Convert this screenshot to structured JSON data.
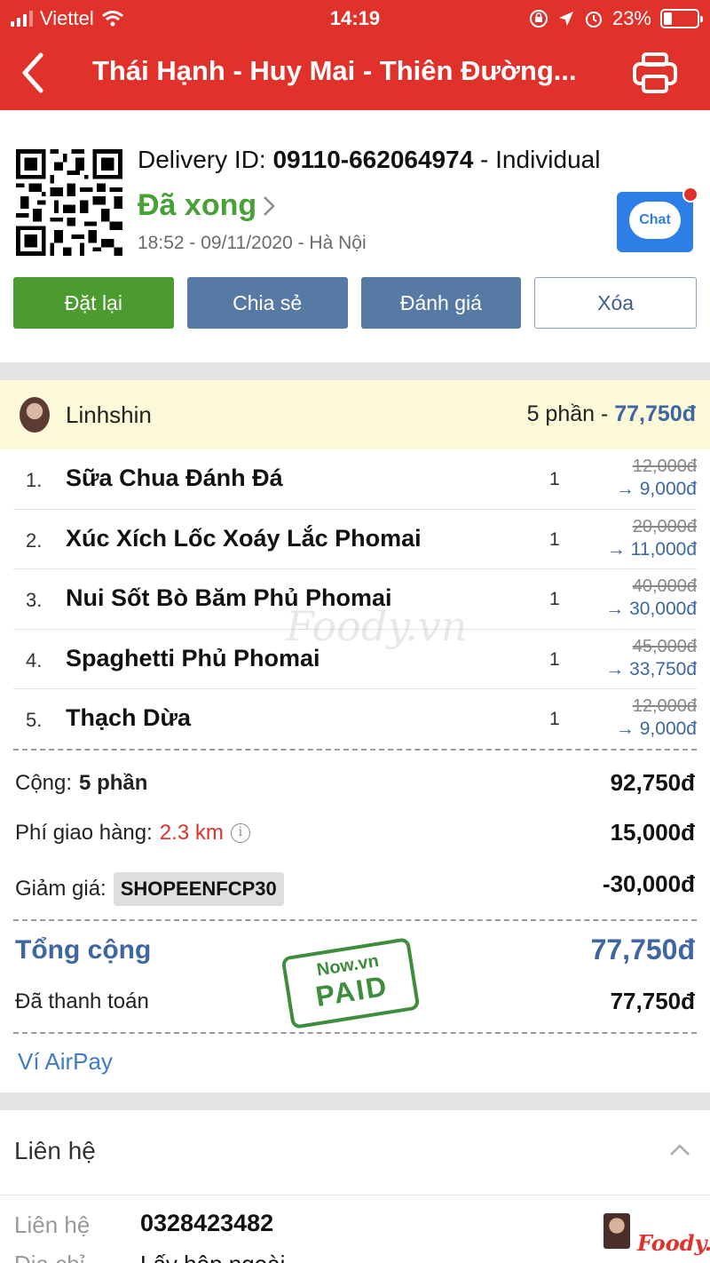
{
  "status_bar": {
    "carrier": "Viettel",
    "time": "14:19",
    "battery": "23%"
  },
  "nav": {
    "title": "Thái Hạnh - Huy Mai - Thiên Đường..."
  },
  "order": {
    "delivery_prefix": "Delivery ID: ",
    "delivery_id": "09110-662064974",
    "delivery_suffix": " - Individual",
    "status": "Đã xong",
    "datetime": "18:52 - 09/11/2020 - Hà Nội",
    "chat_label": "Chat"
  },
  "actions": {
    "reorder": "Đặt lại",
    "share": "Chia sẻ",
    "rate": "Đánh giá",
    "delete": "Xóa"
  },
  "group": {
    "user": "Linhshin",
    "summary_qty": "5 phần",
    "summary_sep": " - ",
    "summary_total": "77,750đ"
  },
  "items": [
    {
      "num": "1.",
      "name": "Sữa Chua Đánh Đá",
      "qty": "1",
      "old_price": "12,000đ",
      "new_price": "→ 9,000đ"
    },
    {
      "num": "2.",
      "name": "Xúc Xích Lốc Xoáy Lắc Phomai",
      "qty": "1",
      "old_price": "20,000đ",
      "new_price": "→ 11,000đ"
    },
    {
      "num": "3.",
      "name": "Nui Sốt Bò Băm Phủ Phomai",
      "qty": "1",
      "old_price": "40,000đ",
      "new_price": "→ 30,000đ"
    },
    {
      "num": "4.",
      "name": "Spaghetti Phủ Phomai",
      "qty": "1",
      "old_price": "45,000đ",
      "new_price": "→ 33,750đ"
    },
    {
      "num": "5.",
      "name": "Thạch Dừa",
      "qty": "1",
      "old_price": "12,000đ",
      "new_price": "→ 9,000đ"
    }
  ],
  "summary": {
    "subtotal_label": "Cộng:",
    "subtotal_count": "5 phần",
    "subtotal_value": "92,750đ",
    "shipping_label": "Phí giao hàng:",
    "shipping_distance": "2.3 km",
    "shipping_value": "15,000đ",
    "discount_label": "Giảm giá:",
    "discount_code": "SHOPEENFCP30",
    "discount_value": "-30,000đ",
    "total_label": "Tổng cộng",
    "total_value": "77,750đ",
    "paid_label": "Đã thanh toán",
    "paid_value": "77,750đ",
    "stamp_line1": "Now.vn",
    "stamp_line2": "PAID",
    "watermark": "Foody.vn"
  },
  "payment_method": "Ví AirPay",
  "contact": {
    "section_title": "Liên hệ",
    "contact_label": "Liên hệ",
    "phone": "0328423482",
    "address_label": "Địa chỉ",
    "address": "Lấy hộp ngoài",
    "logo": "Foody.vn"
  },
  "colors": {
    "brand_red": "#e0312b",
    "done_green": "#47a137",
    "accent_blue": "#3d66a3"
  }
}
